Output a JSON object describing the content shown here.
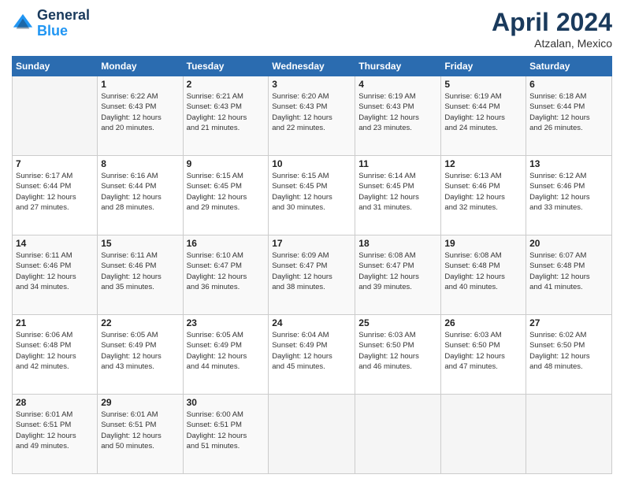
{
  "header": {
    "logo_line1": "General",
    "logo_line2": "Blue",
    "month": "April 2024",
    "location": "Atzalan, Mexico"
  },
  "days_of_week": [
    "Sunday",
    "Monday",
    "Tuesday",
    "Wednesday",
    "Thursday",
    "Friday",
    "Saturday"
  ],
  "weeks": [
    [
      {
        "num": "",
        "sunrise": "",
        "sunset": "",
        "daylight": ""
      },
      {
        "num": "1",
        "sunrise": "Sunrise: 6:22 AM",
        "sunset": "Sunset: 6:43 PM",
        "daylight": "Daylight: 12 hours and 20 minutes."
      },
      {
        "num": "2",
        "sunrise": "Sunrise: 6:21 AM",
        "sunset": "Sunset: 6:43 PM",
        "daylight": "Daylight: 12 hours and 21 minutes."
      },
      {
        "num": "3",
        "sunrise": "Sunrise: 6:20 AM",
        "sunset": "Sunset: 6:43 PM",
        "daylight": "Daylight: 12 hours and 22 minutes."
      },
      {
        "num": "4",
        "sunrise": "Sunrise: 6:19 AM",
        "sunset": "Sunset: 6:43 PM",
        "daylight": "Daylight: 12 hours and 23 minutes."
      },
      {
        "num": "5",
        "sunrise": "Sunrise: 6:19 AM",
        "sunset": "Sunset: 6:44 PM",
        "daylight": "Daylight: 12 hours and 24 minutes."
      },
      {
        "num": "6",
        "sunrise": "Sunrise: 6:18 AM",
        "sunset": "Sunset: 6:44 PM",
        "daylight": "Daylight: 12 hours and 26 minutes."
      }
    ],
    [
      {
        "num": "7",
        "sunrise": "Sunrise: 6:17 AM",
        "sunset": "Sunset: 6:44 PM",
        "daylight": "Daylight: 12 hours and 27 minutes."
      },
      {
        "num": "8",
        "sunrise": "Sunrise: 6:16 AM",
        "sunset": "Sunset: 6:44 PM",
        "daylight": "Daylight: 12 hours and 28 minutes."
      },
      {
        "num": "9",
        "sunrise": "Sunrise: 6:15 AM",
        "sunset": "Sunset: 6:45 PM",
        "daylight": "Daylight: 12 hours and 29 minutes."
      },
      {
        "num": "10",
        "sunrise": "Sunrise: 6:15 AM",
        "sunset": "Sunset: 6:45 PM",
        "daylight": "Daylight: 12 hours and 30 minutes."
      },
      {
        "num": "11",
        "sunrise": "Sunrise: 6:14 AM",
        "sunset": "Sunset: 6:45 PM",
        "daylight": "Daylight: 12 hours and 31 minutes."
      },
      {
        "num": "12",
        "sunrise": "Sunrise: 6:13 AM",
        "sunset": "Sunset: 6:46 PM",
        "daylight": "Daylight: 12 hours and 32 minutes."
      },
      {
        "num": "13",
        "sunrise": "Sunrise: 6:12 AM",
        "sunset": "Sunset: 6:46 PM",
        "daylight": "Daylight: 12 hours and 33 minutes."
      }
    ],
    [
      {
        "num": "14",
        "sunrise": "Sunrise: 6:11 AM",
        "sunset": "Sunset: 6:46 PM",
        "daylight": "Daylight: 12 hours and 34 minutes."
      },
      {
        "num": "15",
        "sunrise": "Sunrise: 6:11 AM",
        "sunset": "Sunset: 6:46 PM",
        "daylight": "Daylight: 12 hours and 35 minutes."
      },
      {
        "num": "16",
        "sunrise": "Sunrise: 6:10 AM",
        "sunset": "Sunset: 6:47 PM",
        "daylight": "Daylight: 12 hours and 36 minutes."
      },
      {
        "num": "17",
        "sunrise": "Sunrise: 6:09 AM",
        "sunset": "Sunset: 6:47 PM",
        "daylight": "Daylight: 12 hours and 38 minutes."
      },
      {
        "num": "18",
        "sunrise": "Sunrise: 6:08 AM",
        "sunset": "Sunset: 6:47 PM",
        "daylight": "Daylight: 12 hours and 39 minutes."
      },
      {
        "num": "19",
        "sunrise": "Sunrise: 6:08 AM",
        "sunset": "Sunset: 6:48 PM",
        "daylight": "Daylight: 12 hours and 40 minutes."
      },
      {
        "num": "20",
        "sunrise": "Sunrise: 6:07 AM",
        "sunset": "Sunset: 6:48 PM",
        "daylight": "Daylight: 12 hours and 41 minutes."
      }
    ],
    [
      {
        "num": "21",
        "sunrise": "Sunrise: 6:06 AM",
        "sunset": "Sunset: 6:48 PM",
        "daylight": "Daylight: 12 hours and 42 minutes."
      },
      {
        "num": "22",
        "sunrise": "Sunrise: 6:05 AM",
        "sunset": "Sunset: 6:49 PM",
        "daylight": "Daylight: 12 hours and 43 minutes."
      },
      {
        "num": "23",
        "sunrise": "Sunrise: 6:05 AM",
        "sunset": "Sunset: 6:49 PM",
        "daylight": "Daylight: 12 hours and 44 minutes."
      },
      {
        "num": "24",
        "sunrise": "Sunrise: 6:04 AM",
        "sunset": "Sunset: 6:49 PM",
        "daylight": "Daylight: 12 hours and 45 minutes."
      },
      {
        "num": "25",
        "sunrise": "Sunrise: 6:03 AM",
        "sunset": "Sunset: 6:50 PM",
        "daylight": "Daylight: 12 hours and 46 minutes."
      },
      {
        "num": "26",
        "sunrise": "Sunrise: 6:03 AM",
        "sunset": "Sunset: 6:50 PM",
        "daylight": "Daylight: 12 hours and 47 minutes."
      },
      {
        "num": "27",
        "sunrise": "Sunrise: 6:02 AM",
        "sunset": "Sunset: 6:50 PM",
        "daylight": "Daylight: 12 hours and 48 minutes."
      }
    ],
    [
      {
        "num": "28",
        "sunrise": "Sunrise: 6:01 AM",
        "sunset": "Sunset: 6:51 PM",
        "daylight": "Daylight: 12 hours and 49 minutes."
      },
      {
        "num": "29",
        "sunrise": "Sunrise: 6:01 AM",
        "sunset": "Sunset: 6:51 PM",
        "daylight": "Daylight: 12 hours and 50 minutes."
      },
      {
        "num": "30",
        "sunrise": "Sunrise: 6:00 AM",
        "sunset": "Sunset: 6:51 PM",
        "daylight": "Daylight: 12 hours and 51 minutes."
      },
      {
        "num": "",
        "sunrise": "",
        "sunset": "",
        "daylight": ""
      },
      {
        "num": "",
        "sunrise": "",
        "sunset": "",
        "daylight": ""
      },
      {
        "num": "",
        "sunrise": "",
        "sunset": "",
        "daylight": ""
      },
      {
        "num": "",
        "sunrise": "",
        "sunset": "",
        "daylight": ""
      }
    ]
  ]
}
